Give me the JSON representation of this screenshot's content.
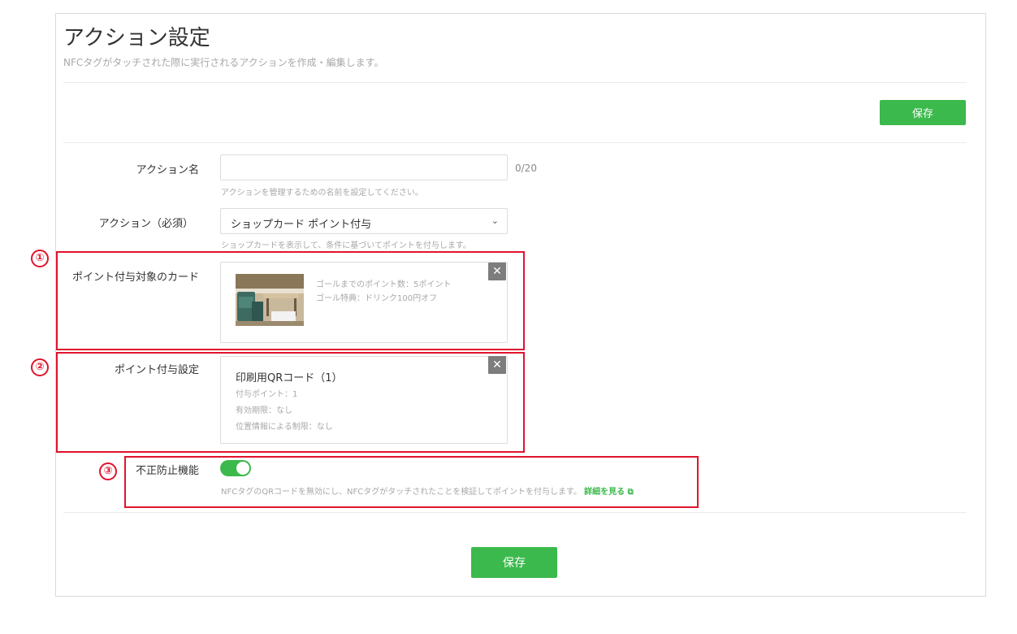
{
  "header": {
    "title": "アクション設定",
    "subtitle": "NFCタグがタッチされた際に実行されるアクションを作成・編集します。"
  },
  "toolbar": {
    "save_label": "保存"
  },
  "form": {
    "action_name": {
      "label": "アクション名",
      "value": "",
      "placeholder": "",
      "counter": "0/20",
      "help": "アクションを管理するための名前を設定してください。"
    },
    "action_type": {
      "label": "アクション（必須）",
      "selected": "ショップカード ポイント付与",
      "help": "ショップカードを表示して、条件に基づいてポイントを付与します。"
    },
    "target_card": {
      "label": "ポイント付与対象のカード",
      "goal_points": "ゴールまでのポイント数：5ポイント",
      "goal_reward": "ゴール特典：ドリンク100円オフ"
    },
    "point_setting": {
      "label": "ポイント付与設定",
      "name": "印刷用QRコード（1）",
      "points": "付与ポイント：1",
      "expiry": "有効期限：なし",
      "location": "位置情報による制限：なし"
    },
    "fraud_prevention": {
      "label": "不正防止機能",
      "enabled": true,
      "help": "NFCタグのQRコードを無効にし、NFCタグがタッチされたことを検証してポイントを付与します。",
      "link": "詳細を見る"
    }
  },
  "footer": {
    "save_label": "保存"
  },
  "annotations": {
    "one": "①",
    "two": "②",
    "three": "③"
  },
  "colors": {
    "accent": "#3cb94c",
    "highlight": "#e0142d"
  },
  "icons": {
    "close": "close-icon",
    "chevron": "chevron-down-icon",
    "external": "external-link-icon"
  }
}
